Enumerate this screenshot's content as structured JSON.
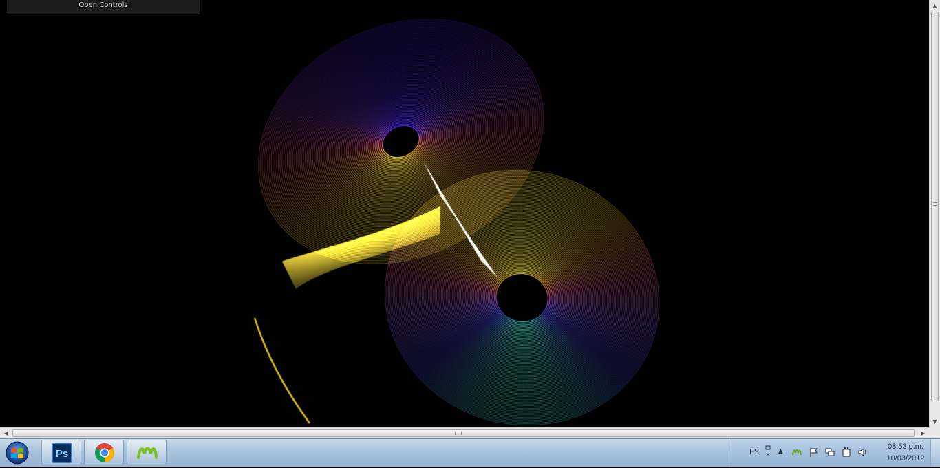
{
  "controls": {
    "open_label": "Open Controls"
  },
  "visualization": {
    "left_lobe_colors": [
      "#3a1fd8",
      "#7a2fc8",
      "#c2486a",
      "#d9883a",
      "#f2d23a"
    ],
    "right_lobe_colors": [
      "#f0e040",
      "#e0a030",
      "#c8507a",
      "#8050d0",
      "#3c3cd8",
      "#40c0b0"
    ]
  },
  "taskbar": {
    "start_icon": "windows-start-icon",
    "apps": [
      {
        "name": "photoshop",
        "icon": "photoshop-icon",
        "label": "Ps"
      },
      {
        "name": "chrome",
        "icon": "chrome-icon"
      },
      {
        "name": "movistar",
        "icon": "movistar-icon"
      }
    ],
    "tray": {
      "language": "ES",
      "time": "08:53 p.m.",
      "date": "10/03/2012"
    }
  }
}
